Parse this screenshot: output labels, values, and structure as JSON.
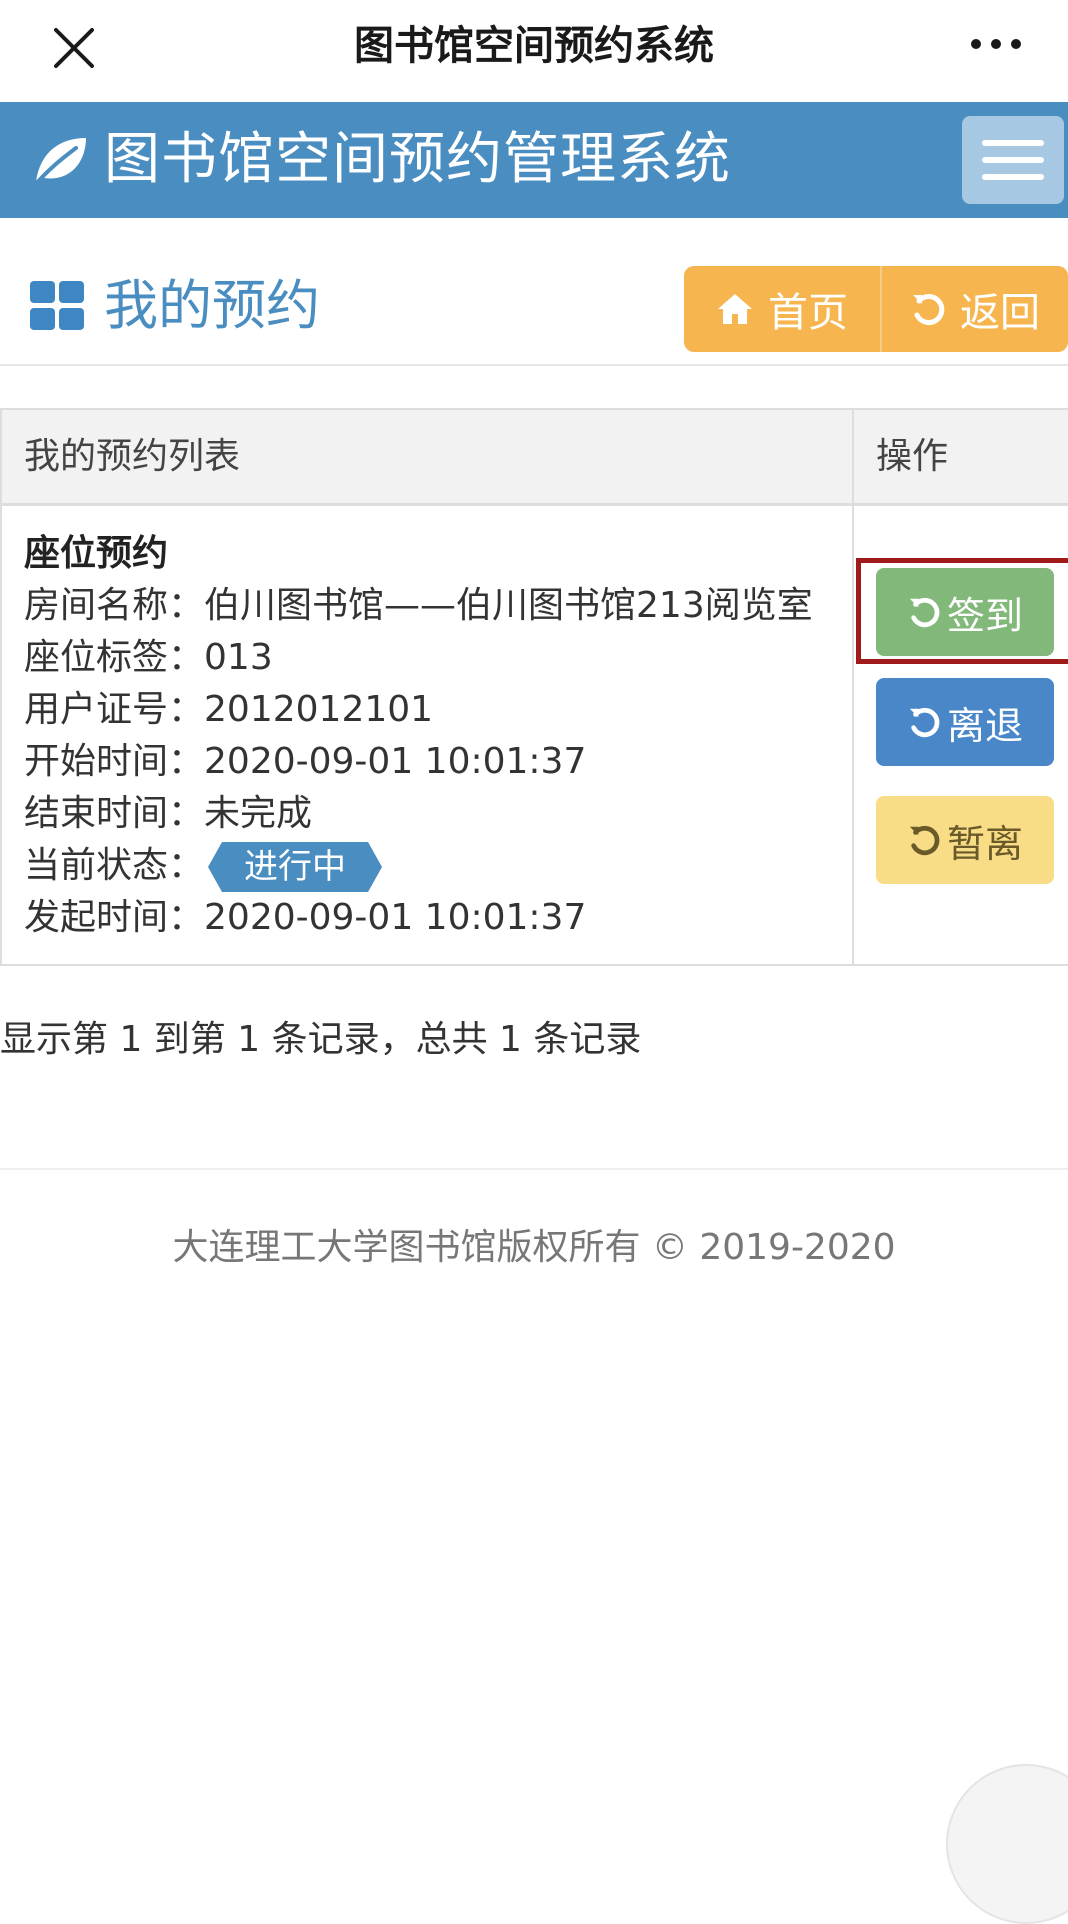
{
  "wechat_bar": {
    "title": "图书馆空间预约系统"
  },
  "header": {
    "app_title": "图书馆空间预约管理系统"
  },
  "page": {
    "title": "我的预约",
    "home_label": "首页",
    "back_label": "返回"
  },
  "table": {
    "headers": [
      "我的预约列表",
      "操作"
    ],
    "record": {
      "type": "座位预约",
      "fields": [
        {
          "label": "房间名称：",
          "value": "伯川图书馆——伯川图书馆213阅览室"
        },
        {
          "label": "座位标签：",
          "value": "013"
        },
        {
          "label": "用户证号：",
          "value": "2012012101"
        },
        {
          "label": "开始时间：",
          "value": "2020-09-01 10:01:37"
        },
        {
          "label": "结束时间：",
          "value": "未完成"
        },
        {
          "label": "当前状态：",
          "value": "进行中"
        },
        {
          "label": "发起时间：",
          "value": "2020-09-01 10:01:37"
        }
      ]
    },
    "actions": {
      "signin": "签到",
      "leave": "离退",
      "pause": "暂离"
    }
  },
  "pagination": {
    "info": "显示第 1 到第 1 条记录，总共 1 条记录"
  },
  "footer": {
    "copyright": "大连理工大学图书馆版权所有 © 2019-2020"
  },
  "colors": {
    "header_blue": "#4a8dc0",
    "orange_button": "#f6b54f",
    "signin_green": "#82b97a",
    "leave_blue": "#4a87c9",
    "pause_yellow": "#f8dc86",
    "highlight_red": "#a01a1a"
  },
  "icons": {
    "close": "close-icon",
    "more": "more-icon",
    "leaf": "leaf-icon",
    "menu": "menu-icon",
    "grid": "grid-icon",
    "home": "home-icon",
    "back": "undo-icon"
  }
}
